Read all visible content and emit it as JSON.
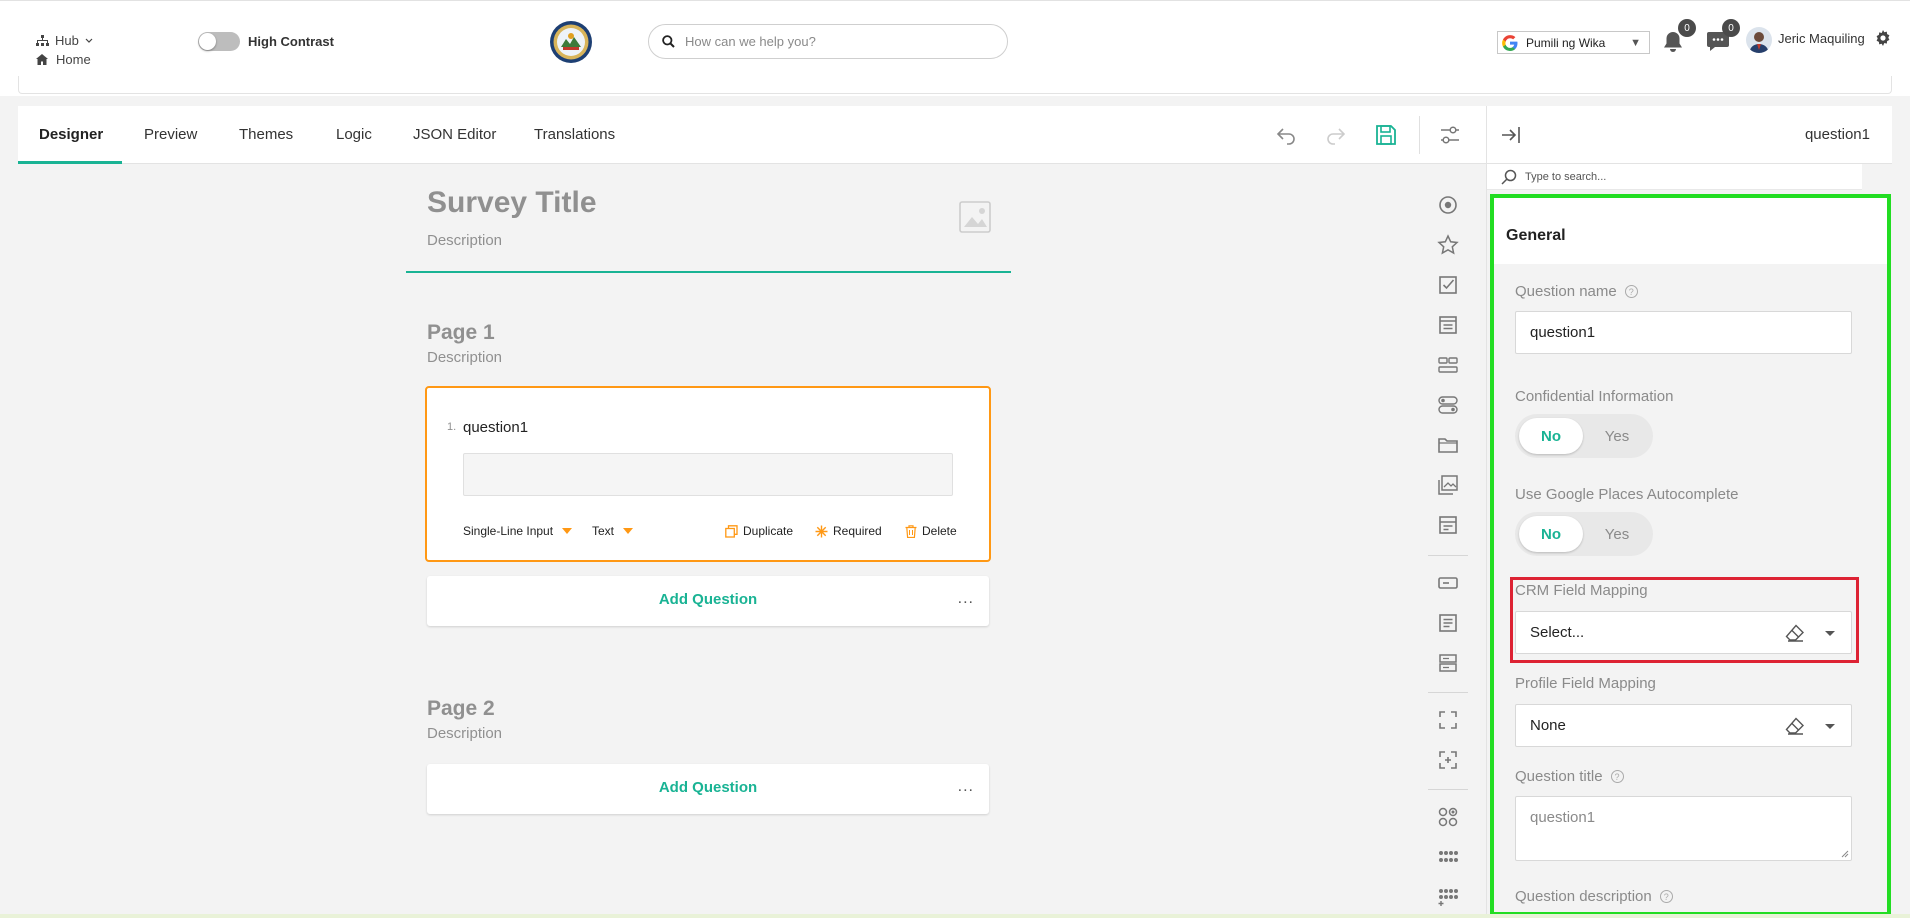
{
  "header": {
    "hub_label": "Hub",
    "home_label": "Home",
    "high_contrast_label": "High Contrast",
    "search_placeholder": "How can we help you?",
    "translate_label": "Pumili ng Wika",
    "notifications_count": "0",
    "messages_count": "0",
    "user_name": "Jeric Maquiling"
  },
  "designer": {
    "tabs": [
      {
        "label": "Designer",
        "active": true
      },
      {
        "label": "Preview",
        "active": false
      },
      {
        "label": "Themes",
        "active": false
      },
      {
        "label": "Logic",
        "active": false
      },
      {
        "label": "JSON Editor",
        "active": false
      },
      {
        "label": "Translations",
        "active": false
      }
    ],
    "survey": {
      "title": "Survey Title",
      "description": "Description"
    },
    "pages": [
      {
        "title": "Page 1",
        "description": "Description",
        "add_label": "Add Question",
        "more": "..."
      },
      {
        "title": "Page 2",
        "description": "Description",
        "add_label": "Add Question",
        "more": "..."
      }
    ],
    "question": {
      "number": "1.",
      "title": "question1",
      "type_label": "Single-Line Input",
      "input_type_label": "Text",
      "duplicate_label": "Duplicate",
      "required_label": "Required",
      "delete_label": "Delete"
    }
  },
  "properties": {
    "header_name": "question1",
    "search_placeholder": "Type to search...",
    "section_title": "General",
    "question_name_label": "Question name",
    "question_name_value": "question1",
    "confidential_label": "Confidential Information",
    "confidential_no": "No",
    "confidential_yes": "Yes",
    "places_label": "Use Google Places Autocomplete",
    "places_no": "No",
    "places_yes": "Yes",
    "crm_label": "CRM Field Mapping",
    "crm_value": "Select...",
    "profile_label": "Profile Field Mapping",
    "profile_value": "None",
    "title_label": "Question title",
    "title_placeholder": "question1",
    "description_label": "Question description",
    "help_glyph": "?"
  },
  "colors": {
    "accent": "#19b394",
    "selected_question_border": "#ff9814",
    "highlight_green": "#22dd22",
    "highlight_red": "#dd2233"
  }
}
